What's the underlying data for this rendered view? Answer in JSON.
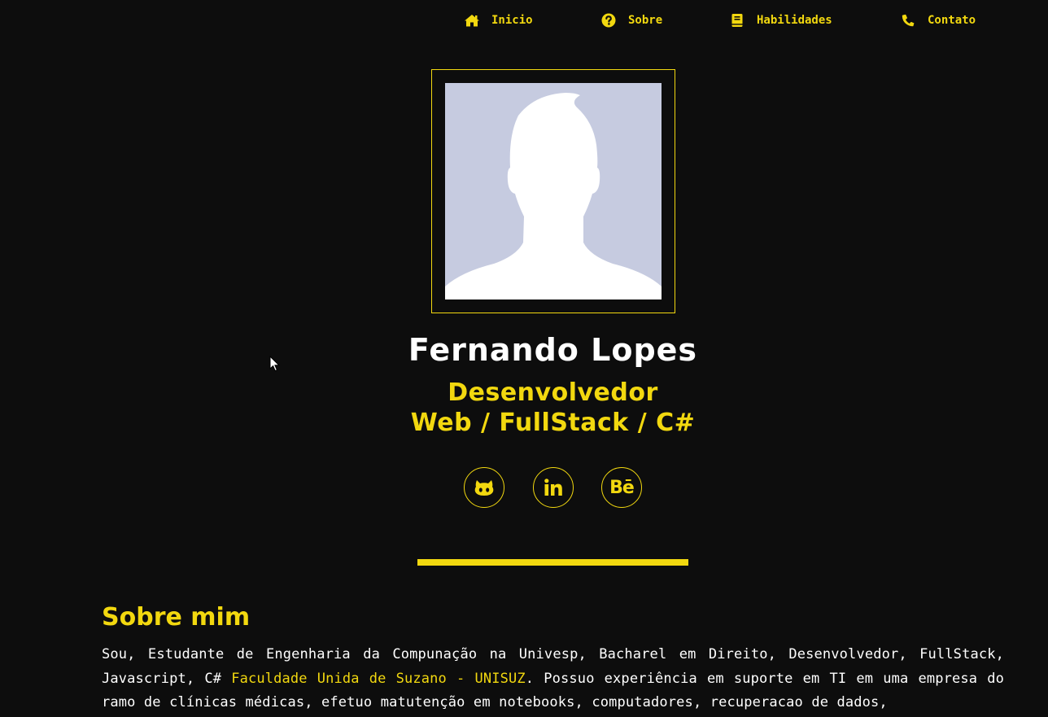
{
  "colors": {
    "background": "#0d0d0d",
    "accent": "#f2d80f",
    "text": "#ffffff",
    "photo_background": "#c6cbe0"
  },
  "nav": {
    "items": [
      {
        "label": "Inicio",
        "icon": "home-icon"
      },
      {
        "label": "Sobre",
        "icon": "question-circle-icon"
      },
      {
        "label": "Habilidades",
        "icon": "book-icon"
      },
      {
        "label": "Contato",
        "icon": "phone-icon"
      }
    ]
  },
  "profile": {
    "name": "Fernando Lopes",
    "role_line1": "Desenvolvedor",
    "role_line2": "Web / FullStack / C#",
    "photo_icon": "profile-silhouette-icon"
  },
  "social": {
    "items": [
      {
        "name": "github",
        "icon": "github-icon"
      },
      {
        "name": "linkedin",
        "icon": "linkedin-icon"
      },
      {
        "name": "behance",
        "icon": "behance-icon",
        "glyph": "Bē"
      }
    ]
  },
  "about": {
    "title": "Sobre mim",
    "text_before": "Sou, Estudante de Engenharia da Compunação na Univesp, Bacharel em Direito, Desenvolvedor, FullStack, Javascript, C# ",
    "highlight": "Faculdade Unida de Suzano - UNISUZ",
    "text_after": ". Possuo experiência em suporte em TI em uma empresa do ramo de clínicas médicas, efetuo matutenção em notebooks, computadores, recuperacao de dados,"
  }
}
